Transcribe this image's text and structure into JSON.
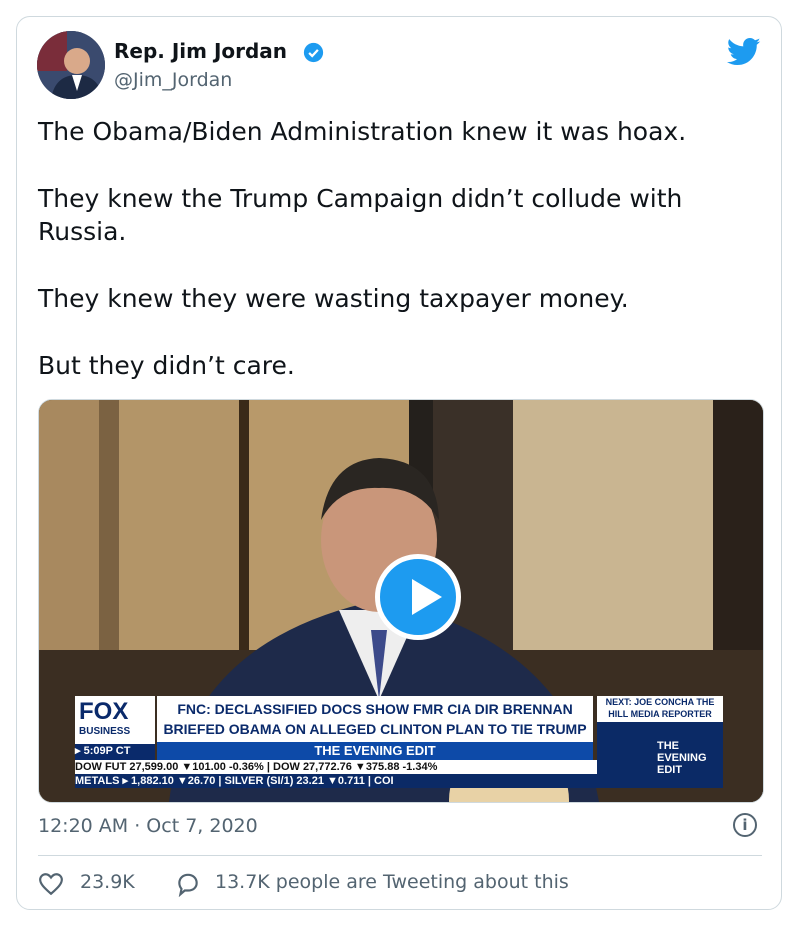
{
  "author": {
    "name": "Rep. Jim Jordan",
    "handle": "@Jim_Jordan",
    "verified": true
  },
  "tweet": {
    "paragraphs": [
      "The Obama/Biden Administration knew it was hoax.",
      "They knew the Trump Campaign didn’t collude with Russia.",
      "They knew they were wasting taxpayer money.",
      "But they didn’t care."
    ]
  },
  "media": {
    "type": "video",
    "chyron": {
      "logo": "FOX",
      "network": "BUSINESS",
      "time": "5:09P CT",
      "headline": "FNC: DECLASSIFIED DOCS SHOW FMR CIA DIR BRENNAN BRIEFED OBAMA ON ALLEGED CLINTON PLAN TO TIE TRUMP TO RUSSIA",
      "show": "THE EVENING EDIT",
      "next": "NEXT: JOE CONCHA THE HILL MEDIA REPORTER",
      "next_show": "THE EVENING EDIT",
      "ticker_row1": "DOW FUT 27,599.00 ▼101.00 -0.36% | DOW 27,772.76 ▼375.88 -1.34%",
      "ticker_row2": "METALS ▸ 1,882.10 ▼26.70 | SILVER (SI/1) 23.21 ▼0.711 | COI"
    }
  },
  "footer": {
    "timestamp": "12:20 AM · Oct 7, 2020",
    "likes": "23.9K",
    "tweeting": "13.7K people are Tweeting about this"
  },
  "colors": {
    "twitter_blue": "#1d9bf0",
    "text_primary": "#0f1419",
    "text_secondary": "#536471",
    "border": "#cfd9de"
  },
  "icons": [
    "verified-badge-icon",
    "twitter-bird-icon",
    "play-icon",
    "info-icon",
    "heart-icon",
    "reply-bubble-icon"
  ]
}
